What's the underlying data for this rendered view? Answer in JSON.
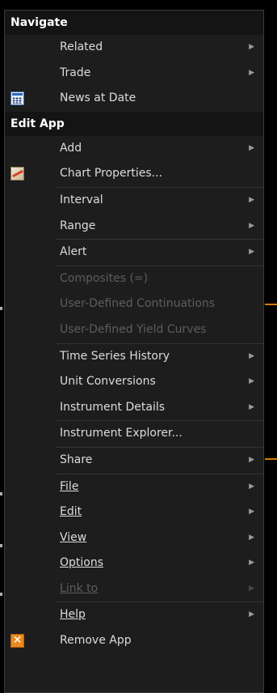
{
  "menu": {
    "navigate_header": "Navigate",
    "related": "Related",
    "trade": "Trade",
    "news_at_date": "News at Date",
    "edit_app_header": "Edit App",
    "add": "Add",
    "chart_properties": "Chart Properties...",
    "interval": "Interval",
    "range": "Range",
    "alert": "Alert",
    "composites": "Composites (=)",
    "user_defined_continuations": "User-Defined Continuations",
    "user_defined_yield_curves": "User-Defined Yield Curves",
    "time_series_history": "Time Series History",
    "unit_conversions": "Unit Conversions",
    "instrument_details": "Instrument Details",
    "instrument_explorer": "Instrument Explorer...",
    "share": "Share",
    "file": "File",
    "edit": "Edit",
    "view": "View",
    "options": "Options",
    "link_to": "Link to",
    "help": "Help",
    "remove_app": "Remove App",
    "submenu_arrow": "▶",
    "remove_glyph": "✕"
  },
  "icons": {
    "news_at_date": "calendar-icon",
    "chart_properties": "chart-icon",
    "remove_app": "remove-icon"
  },
  "colors": {
    "menu_background": "#1d1d1d",
    "header_background": "#141414",
    "text": "#dcdcdc",
    "disabled_text": "#5d5d5d"
  }
}
